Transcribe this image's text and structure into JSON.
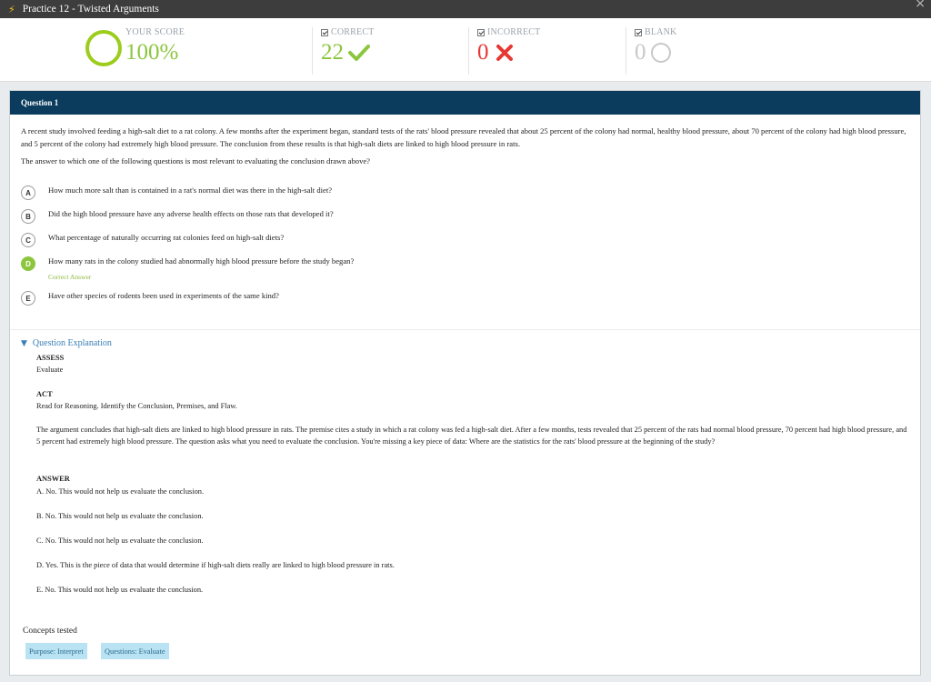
{
  "window": {
    "title": "Practice 12 - Twisted Arguments",
    "close_glyph": "×"
  },
  "score": {
    "your_score_label": "YOUR SCORE",
    "your_score_value": "100%",
    "correct_label": "CORRECT",
    "correct_value": "22",
    "incorrect_label": "INCORRECT",
    "incorrect_value": "0",
    "blank_label": "BLANK",
    "blank_value": "0",
    "colors": {
      "correct": "#8cc63f",
      "incorrect": "#e53935",
      "blank": "#c8c8c8",
      "ring": "#9ccc1c"
    }
  },
  "question": {
    "header": "Question 1",
    "stem": "A recent study involved feeding a high-salt diet to a rat colony. A few months after the experiment began, standard tests of the rats' blood pressure revealed that about 25 percent of the colony had normal, healthy blood pressure, about 70 percent of the colony had high blood pressure, and 5 percent of the colony had extremely high blood pressure. The conclusion from these results is that high-salt diets are linked to high blood pressure in rats.",
    "prompt": "The answer to which one of the following questions is most relevant to evaluating the conclusion drawn above?",
    "choices": [
      {
        "letter": "A",
        "text": "How much more salt than is contained in a rat's normal diet was there in the high-salt diet?"
      },
      {
        "letter": "B",
        "text": "Did the high blood pressure have any adverse health effects on those rats that developed it?"
      },
      {
        "letter": "C",
        "text": "What percentage of naturally occurring rat colonies feed on high-salt diets?"
      },
      {
        "letter": "D",
        "text": "How many rats in the colony studied had abnormally high blood pressure before the study began?",
        "correct": true
      },
      {
        "letter": "E",
        "text": "Have other species of rodents been used in experiments of the same kind?"
      }
    ],
    "correct_answer_label": "Correct Answer"
  },
  "explanation": {
    "toggle_label": "Question Explanation",
    "assess_heading": "ASSESS",
    "assess_text": "Evaluate",
    "act_heading": "ACT",
    "act_text": "Read for Reasoning. Identify the Conclusion, Premises, and Flaw.",
    "analysis": "The argument concludes that high-salt diets are linked to high blood pressure in rats. The premise cites a study in which a rat colony was fed a high-salt diet. After a few months, tests revealed that 25 percent of the rats had normal blood pressure, 70 percent had high blood pressure, and 5 percent had extremely high blood pressure. The question asks what you need to evaluate the conclusion. You're missing a key piece of data: Where are the statistics for the rats' blood pressure at the beginning of the study?",
    "answer_heading": "ANSWER",
    "answers": [
      "A. No. This would not help us evaluate the conclusion.",
      "B. No. This would not help us evaluate the conclusion.",
      "C. No. This would not help us evaluate the conclusion.",
      "D. Yes. This is the piece of data that would determine if high-salt diets really are linked to high blood pressure in rats.",
      "E. No. This would not help us evaluate the conclusion."
    ]
  },
  "concepts": {
    "label": "Concepts tested",
    "tags": [
      "Purpose: Interpret",
      "Questions: Evaluate"
    ]
  }
}
